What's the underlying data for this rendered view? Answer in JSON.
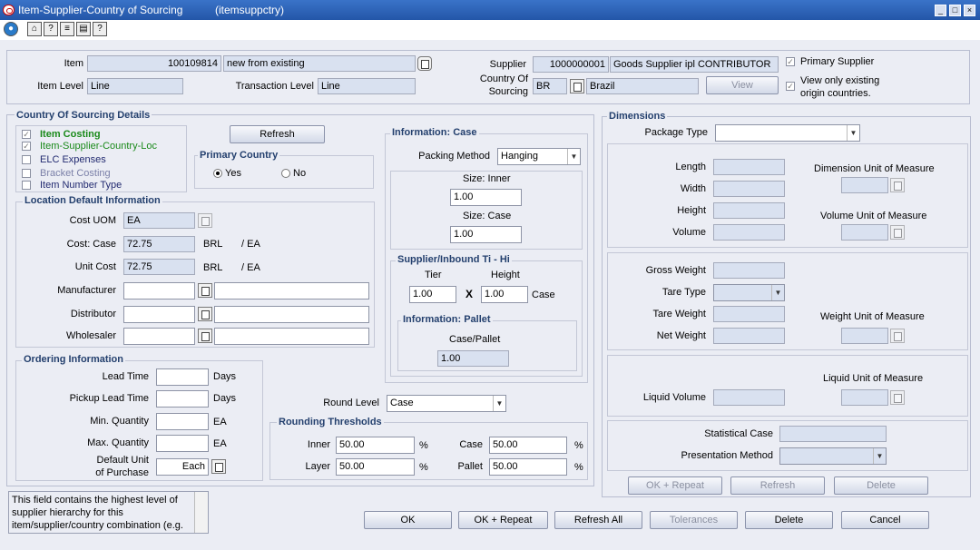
{
  "window": {
    "title": "Item-Supplier-Country of Sourcing",
    "module": "(itemsuppctry)"
  },
  "header": {
    "item_label": "Item",
    "item_id": "100109814",
    "item_desc": "new from existing",
    "item_level_label": "Item Level",
    "item_level": "Line",
    "tran_level_label": "Transaction Level",
    "tran_level": "Line",
    "supplier_label": "Supplier",
    "supplier_id": "1000000001",
    "supplier_name": "Goods Supplier ipl CONTRIBUTOR",
    "cos_label_1": "Country Of",
    "cos_label_2": "Sourcing",
    "country_code": "BR",
    "country_name": "Brazil",
    "view_button": "View",
    "primary_supplier": "Primary Supplier",
    "view_only_1": "View only existing",
    "view_only_2": "origin countries."
  },
  "cos_details": {
    "title": "Country Of Sourcing Details",
    "links": [
      "Item Costing",
      "Item-Supplier-Country-Loc",
      "ELC Expenses",
      "Bracket Costing",
      "Item Number Type"
    ],
    "refresh_button": "Refresh",
    "primary_country_title": "Primary Country",
    "yes": "Yes",
    "no": "No"
  },
  "location_default": {
    "title": "Location Default Information",
    "cost_uom_label": "Cost UOM",
    "cost_uom": "EA",
    "cost_case_label": "Cost: Case",
    "cost_case": "72.75",
    "cost_case_cur": "BRL",
    "cost_case_per": "/ EA",
    "unit_cost_label": "Unit Cost",
    "unit_cost": "72.75",
    "unit_cost_cur": "BRL",
    "unit_cost_per": "/ EA",
    "manufacturer_label": "Manufacturer",
    "distributor_label": "Distributor",
    "wholesaler_label": "Wholesaler"
  },
  "ordering": {
    "title": "Ordering Information",
    "lead_time_label": "Lead Time",
    "days": "Days",
    "pickup_label": "Pickup Lead Time",
    "min_qty_label": "Min. Quantity",
    "max_qty_label": "Max. Quantity",
    "ea": "EA",
    "default_unit_1": "Default Unit",
    "default_unit_2": "of Purchase",
    "default_unit": "Each"
  },
  "info_case": {
    "title": "Information: Case",
    "packing_label": "Packing Method",
    "packing": "Hanging",
    "size_inner_label": "Size: Inner",
    "size_inner": "1.00",
    "size_case_label": "Size: Case",
    "size_case": "1.00"
  },
  "ti_hi": {
    "title": "Supplier/Inbound Ti - Hi",
    "tier_label": "Tier",
    "height_label": "Height",
    "tier": "1.00",
    "height": "1.00",
    "x": "X",
    "case": "Case"
  },
  "info_pallet": {
    "title": "Information: Pallet",
    "case_pallet_label": "Case/Pallet",
    "case_pallet": "1.00"
  },
  "round_level": {
    "label": "Round Level",
    "value": "Case"
  },
  "rounding": {
    "title": "Rounding Thresholds",
    "pct": "%",
    "inner_label": "Inner",
    "inner": "50.00",
    "case_label": "Case",
    "case": "50.00",
    "layer_label": "Layer",
    "layer": "50.00",
    "pallet_label": "Pallet",
    "pallet": "50.00"
  },
  "dimensions": {
    "title": "Dimensions",
    "package_type_label": "Package Type",
    "length": "Length",
    "width": "Width",
    "height": "Height",
    "volume": "Volume",
    "dim_uom": "Dimension Unit of Measure",
    "vol_uom": "Volume Unit of Measure",
    "gross_weight": "Gross Weight",
    "tare_type": "Tare Type",
    "tare_weight": "Tare Weight",
    "net_weight": "Net Weight",
    "weight_uom": "Weight Unit of Measure",
    "liquid_uom": "Liquid Unit of Measure",
    "liquid_volume": "Liquid Volume",
    "statistical_case": "Statistical Case",
    "presentation_method": "Presentation Method",
    "ok_repeat": "OK + Repeat",
    "refresh": "Refresh",
    "delete": "Delete"
  },
  "hint": "This field contains the highest level of supplier hierarchy for this item/supplier/country combination (e.g.",
  "footer": {
    "ok": "OK",
    "ok_repeat": "OK + Repeat",
    "refresh_all": "Refresh All",
    "tolerances": "Tolerances",
    "delete": "Delete",
    "cancel": "Cancel"
  }
}
